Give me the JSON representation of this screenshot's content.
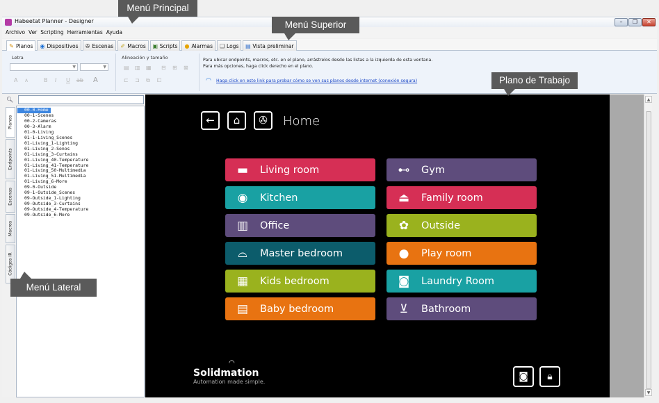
{
  "window": {
    "title": "Habeetat Planner - Designer"
  },
  "menubar": {
    "items": [
      "Archivo",
      "Ver",
      "Scripting",
      "Herramientas",
      "Ayuda"
    ]
  },
  "tabs": [
    {
      "label": "Planos",
      "icon": "pencil-icon",
      "color": "#d38b00"
    },
    {
      "label": "Dispositivos",
      "icon": "wifi-icon",
      "color": "#1a6fd6"
    },
    {
      "label": "Escenas",
      "icon": "reel-icon",
      "color": "#222222"
    },
    {
      "label": "Macros",
      "icon": "script-icon",
      "color": "#c2a31c"
    },
    {
      "label": "Scripts",
      "icon": "code-icon",
      "color": "#3a7d2c"
    },
    {
      "label": "Alarmas",
      "icon": "alarm-icon",
      "color": "#e6a400"
    },
    {
      "label": "Logs",
      "icon": "log-icon",
      "color": "#555555"
    },
    {
      "label": "Vista preliminar",
      "icon": "preview-icon",
      "color": "#2a6bcc"
    }
  ],
  "ribbon": {
    "letra_label": "Letra",
    "alineacion_label": "Alineación y tamaño",
    "hint1": "Para ubicar endpoints, macros, etc. en el plano, arrástrelos desde las listas a la izquierda de esta ventana.",
    "hint2": "Para más opciones, haga click derecho en el plano.",
    "link": "Haga click en este link para probar cómo se ven sus planos desde internet (conexión segura)"
  },
  "sidebar": {
    "vtabs": [
      "Planos",
      "Endpoints",
      "Escenas",
      "Macros",
      "Códigos IR"
    ],
    "tree": [
      "00-0-Home",
      "00-1-Scenes",
      "00-2-Cameras",
      "00-3-Alarm",
      "01-0-Living",
      "01-1-Living_Scenes",
      "01-Living_1-Lighting",
      "01-Living_2-Sonos",
      "01-Living_3-Curtains",
      "01-Living_40-Temperature",
      "01-Living_41-Temperature",
      "01-Living_50-Multimedia",
      "01-Living_51-Multimedia",
      "01-Living_6-More",
      "09-0-Outside",
      "09-1-Outside_Scenes",
      "09-Outside_1-Lighting",
      "09-Outside_3-Curtains",
      "09-Outside_4-Temperature",
      "09-Outside_6-More"
    ]
  },
  "plan": {
    "title": "Home",
    "rooms_left": [
      {
        "label": "Living room",
        "icon": "sofa-icon",
        "color": "#d62f55"
      },
      {
        "label": "Kitchen",
        "icon": "dish-icon",
        "color": "#19a1a3"
      },
      {
        "label": "Office",
        "icon": "binders-icon",
        "color": "#5e4c7c"
      },
      {
        "label": "Master bedroom",
        "icon": "bed-icon",
        "color": "#0c5c6b"
      },
      {
        "label": "Kids bedroom",
        "icon": "bunkbed-icon",
        "color": "#9ab21e"
      },
      {
        "label": "Baby bedroom",
        "icon": "crib-icon",
        "color": "#e87311"
      }
    ],
    "rooms_right": [
      {
        "label": "Gym",
        "icon": "dumbbell-icon",
        "color": "#5e4c7c"
      },
      {
        "label": "Family room",
        "icon": "lamp-icon",
        "color": "#d62f55"
      },
      {
        "label": "Outside",
        "icon": "plant-icon",
        "color": "#9ab21e"
      },
      {
        "label": "Play room",
        "icon": "toys-icon",
        "color": "#e87311"
      },
      {
        "label": "Laundry Room",
        "icon": "washer-icon",
        "color": "#19a1a3"
      },
      {
        "label": "Bathroom",
        "icon": "toilet-icon",
        "color": "#5e4c7c"
      }
    ],
    "brand": "Solidmation",
    "tagline": "Automation made simple."
  },
  "callouts": {
    "menu_principal": "Menú Principal",
    "menu_superior": "Menú Superior",
    "plano_trabajo": "Plano de Trabajo",
    "menu_lateral": "Menú Lateral"
  }
}
